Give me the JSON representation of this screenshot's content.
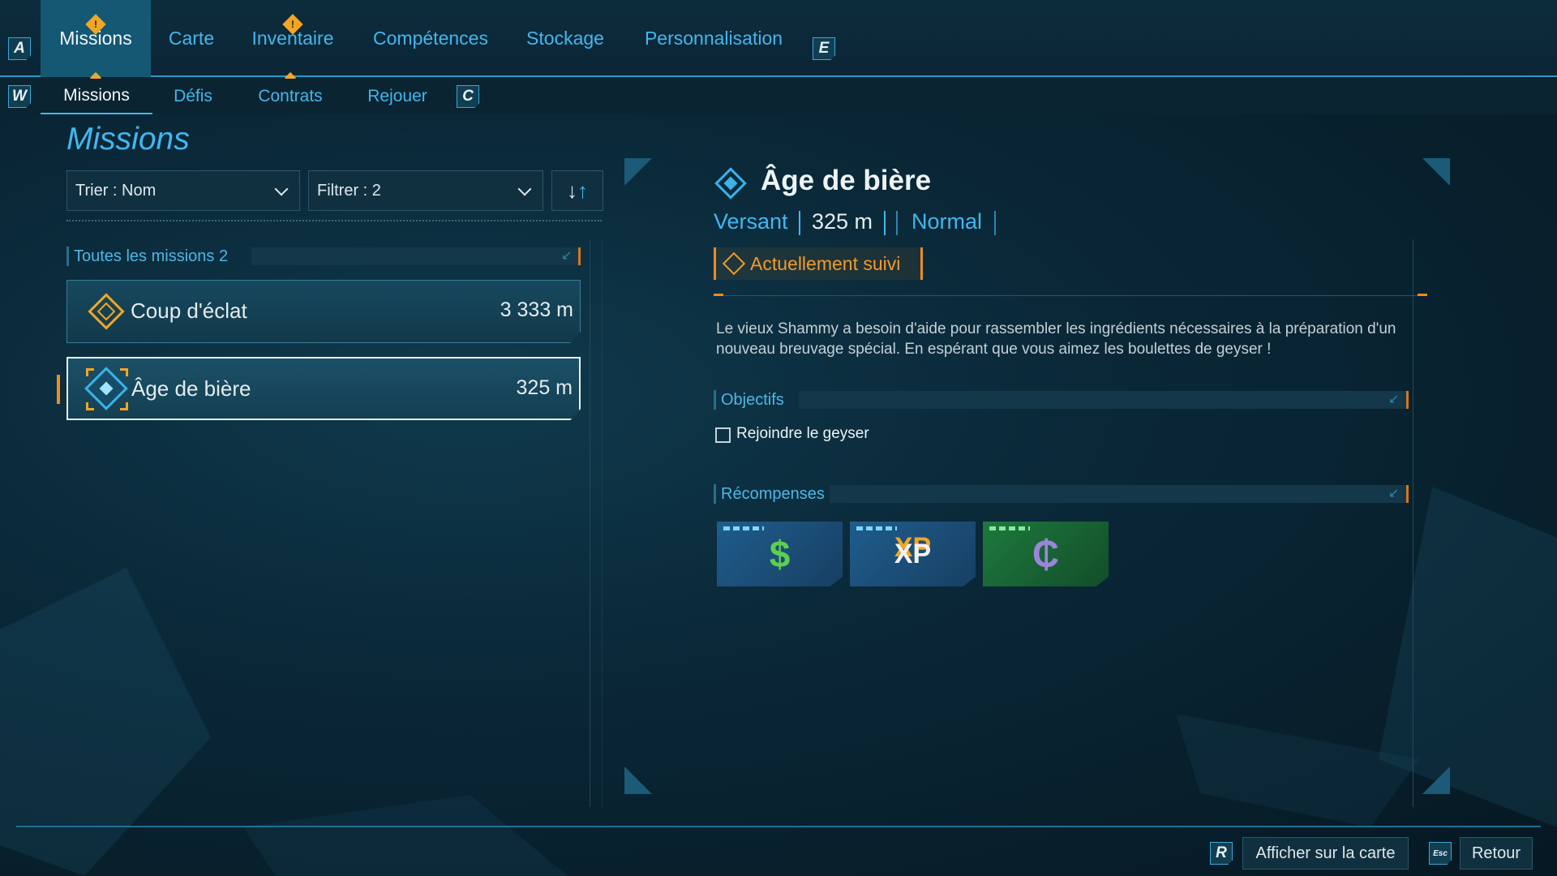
{
  "top_nav": {
    "left_key": "A",
    "right_key": "E",
    "tabs": [
      {
        "label": "Missions",
        "active": true,
        "alert": true
      },
      {
        "label": "Carte",
        "active": false,
        "alert": false
      },
      {
        "label": "Inventaire",
        "active": false,
        "alert": true
      },
      {
        "label": "Compétences",
        "active": false,
        "alert": false
      },
      {
        "label": "Stockage",
        "active": false,
        "alert": false
      },
      {
        "label": "Personnalisation",
        "active": false,
        "alert": false
      }
    ],
    "alert_glyph": "!"
  },
  "sub_nav": {
    "left_key": "W",
    "right_key": "C",
    "tabs": [
      {
        "label": "Missions",
        "active": true
      },
      {
        "label": "Défis",
        "active": false
      },
      {
        "label": "Contrats",
        "active": false
      },
      {
        "label": "Rejouer",
        "active": false
      }
    ]
  },
  "left_panel": {
    "title": "Missions",
    "sort_label": "Trier : Nom",
    "filter_label": "Filtrer : 2",
    "sort_icons": {
      "down": "↓",
      "up": "↑"
    },
    "list_header": "Toutes les missions 2",
    "missions": [
      {
        "name": "Coup d'éclat",
        "distance": "3 333 m",
        "icon": "orange-diamond-icon",
        "selected": false
      },
      {
        "name": "Âge de bière",
        "distance": "325 m",
        "icon": "blue-diamond-icon",
        "selected": true
      }
    ]
  },
  "detail": {
    "title": "Âge de bière",
    "region": "Versant",
    "distance": "325 m",
    "difficulty": "Normal",
    "tracked_label": "Actuellement suivi",
    "description": "Le vieux Shammy a besoin d'aide pour rassembler les ingrédients nécessaires à la préparation d'un nouveau breuvage spécial. En espérant que vous aimez les boulettes de geyser !",
    "objectives_header": "Objectifs",
    "objectives": [
      {
        "label": "Rejoindre le geyser",
        "done": false
      }
    ],
    "rewards_header": "Récompenses",
    "rewards": [
      {
        "icon": "money-icon",
        "glyph": "$",
        "color": "#5fcf4f",
        "bg": "blue"
      },
      {
        "icon": "xp-icon",
        "glyph": "XP",
        "color": "#f1f1f1",
        "bg": "blue"
      },
      {
        "icon": "currency-icon",
        "glyph": "₵",
        "color": "#9b86d8",
        "bg": "green"
      }
    ]
  },
  "footer": {
    "map_key": "R",
    "map_label": "Afficher sur la carte",
    "back_key": "Esc",
    "back_label": "Retour"
  },
  "colors": {
    "accent": "#42b7ee",
    "alert": "#f2a623",
    "tracked": "#f39a2b"
  }
}
